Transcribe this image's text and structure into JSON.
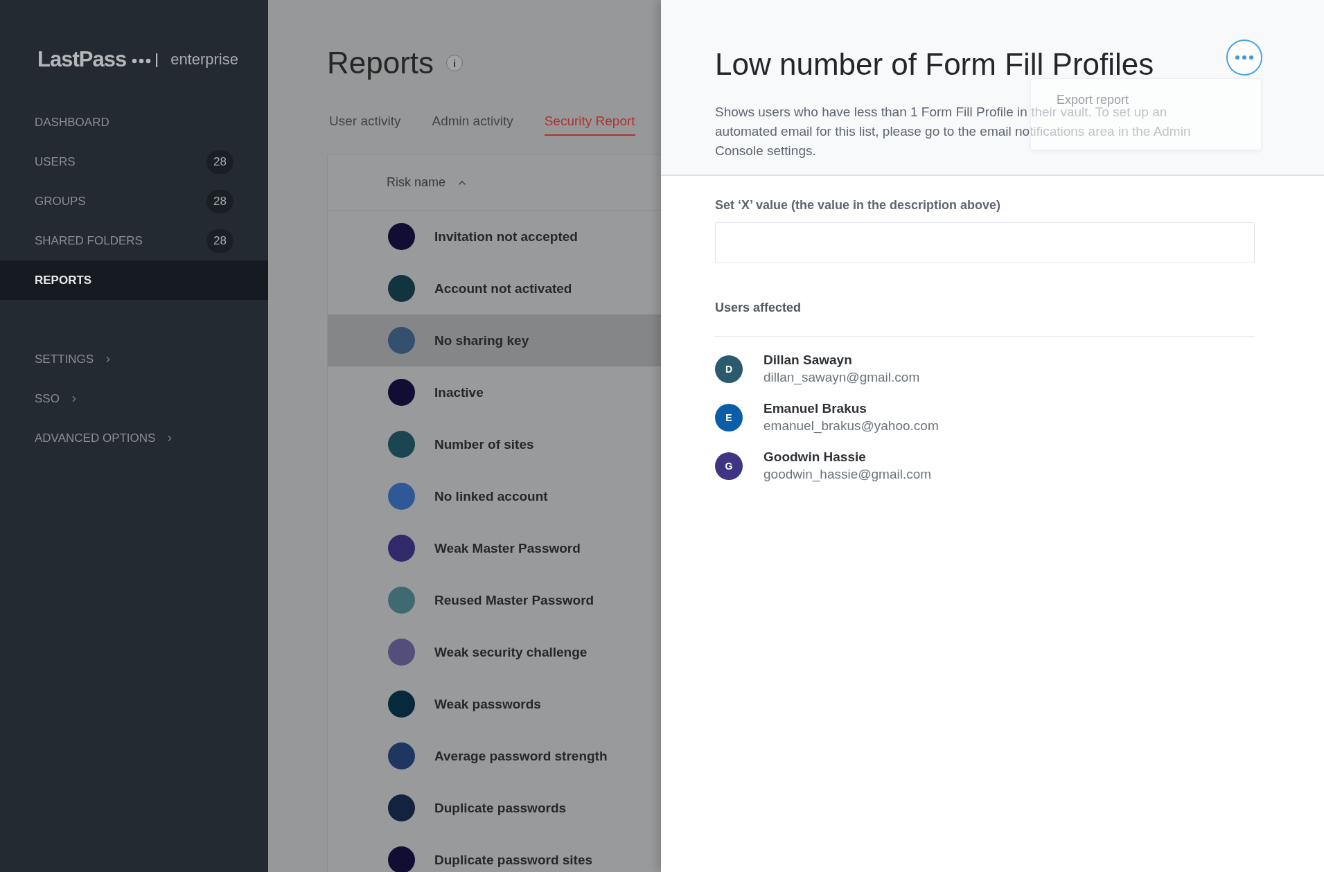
{
  "sidebar": {
    "logo": {
      "brand": "LastPass",
      "edition": "enterprise"
    },
    "items": [
      {
        "label": "DASHBOARD",
        "selected": false
      },
      {
        "label": "USERS",
        "count": "28",
        "selected": false
      },
      {
        "label": "GROUPS",
        "count": "28",
        "selected": false
      },
      {
        "label": "SHARED FOLDERS",
        "count": "28",
        "selected": false
      },
      {
        "label": "REPORTS",
        "selected": true
      }
    ],
    "sections": [
      {
        "label": "SETTINGS"
      },
      {
        "label": "SSO"
      },
      {
        "label": "ADVANCED OPTIONS"
      }
    ]
  },
  "main": {
    "title": "Reports",
    "info": "i",
    "tabs": [
      {
        "label": "User activity",
        "selected": false
      },
      {
        "label": "Admin activity",
        "selected": false
      },
      {
        "label": "Security Report",
        "selected": true
      }
    ],
    "table": {
      "column": "Risk name",
      "rows": [
        {
          "name": "Invitation not accepted",
          "color": "#120d33",
          "selected": false
        },
        {
          "name": "Account not activated",
          "color": "#12343f",
          "selected": false
        },
        {
          "name": "No sharing key",
          "color": "#34506f",
          "selected": true
        },
        {
          "name": "Inactive",
          "color": "#120d33",
          "selected": false
        },
        {
          "name": "Number of sites",
          "color": "#1b4550",
          "selected": false
        },
        {
          "name": "No linked account",
          "color": "#2f5896",
          "selected": false
        },
        {
          "name": "Weak Master Password",
          "color": "#302a6a",
          "selected": false
        },
        {
          "name": "Reused Master Password",
          "color": "#406a72",
          "selected": false
        },
        {
          "name": "Weak security challenge",
          "color": "#534f7a",
          "selected": false
        },
        {
          "name": "Weak passwords",
          "color": "#062a3c",
          "selected": false
        },
        {
          "name": "Average password strength",
          "color": "#1f3760",
          "selected": false
        },
        {
          "name": "Duplicate passwords",
          "color": "#12223f",
          "selected": false
        },
        {
          "name": "Duplicate password sites",
          "color": "#120d33",
          "selected": false
        }
      ]
    }
  },
  "panel": {
    "title": "Low number of Form Fill Profiles",
    "menu": {
      "expanded": true,
      "items": [
        "Export report"
      ]
    },
    "description": "Shows users who have less than 1 Form Fill Profile in their vault. To set up an automated email for this list, please go to the email notifications area in the Admin Console settings.",
    "field_label": "Set ‘X’ value (the value in the description above)",
    "users_heading": "Users affected",
    "users": [
      {
        "initial": "D",
        "name": "Dillan Sawayn",
        "email": "dillan_sawayn@gmail.com",
        "color": "#2b5a6e"
      },
      {
        "initial": "E",
        "name": "Emanuel Brakus",
        "email": "emanuel_brakus@yahoo.com",
        "color": "#0a5ea8"
      },
      {
        "initial": "G",
        "name": "Goodwin Hassie",
        "email": "goodwin_hassie@gmail.com",
        "color": "#3e3585"
      }
    ]
  }
}
